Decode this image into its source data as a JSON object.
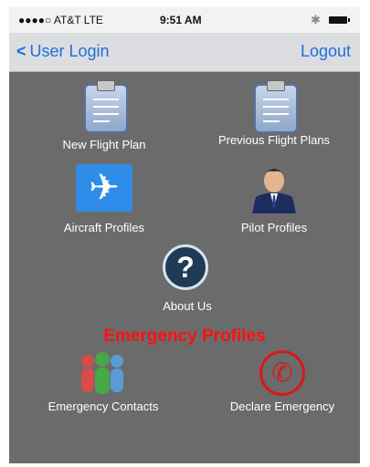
{
  "status_bar": {
    "carrier": "●●●●○ AT&T  LTE",
    "time": "9:51 AM",
    "bluetooth_icon": "bluetooth-icon"
  },
  "nav": {
    "back_label": "User Login",
    "back_icon": "chevron-left-icon",
    "logout_label": "Logout"
  },
  "menu": {
    "new_flight_plan": "New Flight Plan",
    "previous_flight_plans": "Previous Flight Plans",
    "aircraft_profiles": "Aircraft Profiles",
    "pilot_profiles": "Pilot Profiles",
    "about_us": "About Us"
  },
  "emergency": {
    "section_title": "Emergency Profiles",
    "contacts": "Emergency Contacts",
    "declare": "Declare Emergency"
  },
  "colors": {
    "accent": "#1b6fdc",
    "background": "#6b6b6b",
    "emergency": "#ff1010"
  }
}
